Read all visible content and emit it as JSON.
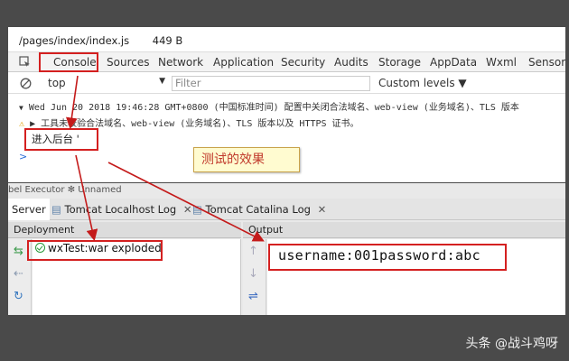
{
  "devtools": {
    "file_path": "/pages/index/index.js",
    "file_size": "449 B",
    "tabs": [
      "Console",
      "Sources",
      "Network",
      "Application",
      "Security",
      "Audits",
      "Storage",
      "AppData",
      "Wxml",
      "Sensor"
    ],
    "context": "top",
    "filter_placeholder": "Filter",
    "levels": "Custom levels ▼",
    "warn_line1": "Wed Jun 20 2018 19:46:28 GMT+0800 (中国标准时间) 配置中关闭合法域名、web-view (业务域名)、TLS 版本",
    "warn_line2": "▶ 工具未校验合法域名、web-view (业务域名)、TLS 版本以及 HTTPS 证书。",
    "log_line": "进入后台 '",
    "prompt": ">"
  },
  "note": "测试的效果",
  "ide": {
    "top_strip": "bel Executor  ✻ Unnamed",
    "tabs": [
      "Server",
      "Tomcat Localhost Log",
      "Tomcat Catalina Log"
    ],
    "deployment_header": "Deployment",
    "output_header": "Output",
    "deployment_item": "wxTest:war exploded",
    "output_text": "username:001password:abc"
  },
  "watermark": "头条 @战斗鸡呀",
  "colors": {
    "highlight": "#d42020",
    "note_bg": "#fffbd0",
    "note_text": "#c0392b",
    "background": "#4a4a4a"
  }
}
